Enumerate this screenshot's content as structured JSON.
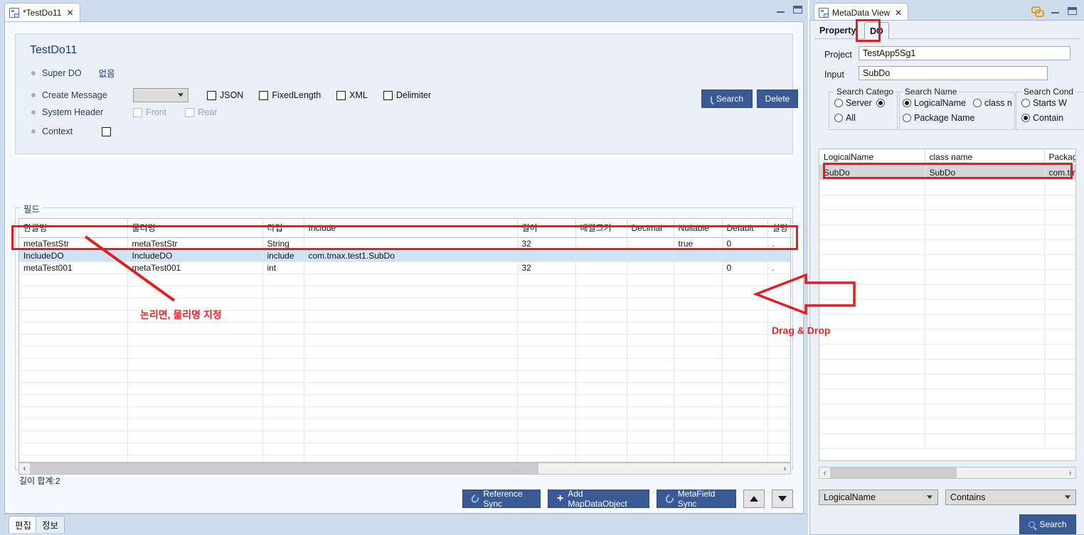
{
  "editor": {
    "tab": {
      "label": "*TestDo11",
      "close": "✕",
      "icon": "do-file-icon"
    },
    "window_buttons": {
      "minimize": "minimize-icon",
      "maximize": "maximize-icon"
    },
    "header": {
      "title": "TestDo11",
      "rows": {
        "super_do": {
          "label": "Super DO",
          "value": "없음"
        },
        "create_message": {
          "label": "Create Message",
          "dropdown_value": ""
        },
        "system_header": {
          "label": "System Header"
        },
        "context": {
          "label": "Context"
        }
      },
      "checkboxes": [
        {
          "label": "JSON",
          "checked": false,
          "enabled": true
        },
        {
          "label": "FixedLength",
          "checked": false,
          "enabled": true
        },
        {
          "label": "XML",
          "checked": false,
          "enabled": true
        },
        {
          "label": "Delimiter",
          "checked": false,
          "enabled": true
        },
        {
          "label": "Front",
          "checked": false,
          "enabled": false
        },
        {
          "label": "Rear",
          "checked": false,
          "enabled": false
        }
      ],
      "buttons": {
        "search": "Search",
        "delete": "Delete"
      }
    },
    "field_section": {
      "legend": "필드",
      "columns": [
        "한글명",
        "물리명",
        "타입",
        "Include",
        "길이",
        "배열크기",
        "Decimal",
        "Nullable",
        "Default",
        "설명"
      ],
      "rows": [
        {
          "indent": 1,
          "twisty": "",
          "cells": [
            "metaTestStr",
            "metaTestStr",
            "String",
            "",
            "32",
            "",
            "",
            "true",
            "0",
            ".",
            ""
          ],
          "selected": false
        },
        {
          "indent": 0,
          "twisty": "⌄",
          "cells": [
            "IncludeDO",
            "IncludeDO",
            "include",
            "com.tmax.test1.SubDo",
            "",
            "",
            "",
            "",
            "",
            "",
            ""
          ],
          "selected": true
        },
        {
          "indent": 1,
          "twisty": "",
          "cells": [
            "metaTest001",
            "metaTest001",
            "int",
            "",
            "32",
            "",
            "",
            "",
            "0",
            ".",
            ""
          ],
          "selected": false
        }
      ],
      "empty_row_count": 16,
      "hscroll": {
        "left_arrow": "‹",
        "right_arrow": "›"
      },
      "length_total": "길이 합계:2"
    },
    "toolbar": [
      {
        "label": "Reference Sync",
        "icon": "refresh-icon"
      },
      {
        "label": "Add MapDataObject",
        "icon": "plus-icon"
      },
      {
        "label": "MetaField Sync",
        "icon": "refresh-icon"
      }
    ],
    "move_buttons": {
      "up": "move-up-icon",
      "down": "move-down-icon"
    },
    "bottom_tabs": [
      {
        "label": "편집",
        "active": true
      },
      {
        "label": "정보",
        "active": false
      }
    ]
  },
  "metadata_view": {
    "tab": {
      "label": "MetaData View",
      "close": "✕",
      "icon": "metadata-icon"
    },
    "window_buttons": {
      "link": "link-icon",
      "minimize": "minimize-icon",
      "maximize": "maximize-icon"
    },
    "inner_tabs": [
      {
        "label": "Property",
        "active": false
      },
      {
        "label": "DO",
        "active": true
      }
    ],
    "fields": {
      "project": {
        "label": "Project",
        "value": "TestApp5Sg1"
      },
      "input": {
        "label": "Input",
        "value": "SubDo"
      }
    },
    "groups": [
      {
        "title": "Search Catego",
        "options": [
          {
            "label": "Server",
            "selected": false
          },
          {
            "label": "",
            "selected": true
          },
          {
            "label": "All",
            "selected": false
          }
        ]
      },
      {
        "title": "Search Name",
        "options": [
          {
            "label": "LogicalName",
            "selected": true
          },
          {
            "label": "class n",
            "selected": false
          },
          {
            "label": "Package Name",
            "selected": false
          }
        ]
      },
      {
        "title": "Search Cond",
        "options": [
          {
            "label": "Starts W",
            "selected": false
          },
          {
            "label": "Contain",
            "selected": true
          }
        ]
      }
    ],
    "result_table": {
      "columns": [
        "LogicalName",
        "class name",
        "Packag"
      ],
      "rows": [
        {
          "cells": [
            "SubDo",
            "SubDo",
            "com.tm"
          ],
          "selected": true
        }
      ],
      "empty_row_count": 18,
      "hscroll": {
        "left_arrow": "‹",
        "right_arrow": "›"
      }
    },
    "bottom_controls": {
      "field_select": "LogicalName",
      "condition_select": "Contains",
      "search_button": "Search"
    }
  },
  "annotations": {
    "field_name_note": "논리면, 물리명 지정",
    "drag_drop_note": "Drag & Drop",
    "accent_color": "#e8252a"
  }
}
